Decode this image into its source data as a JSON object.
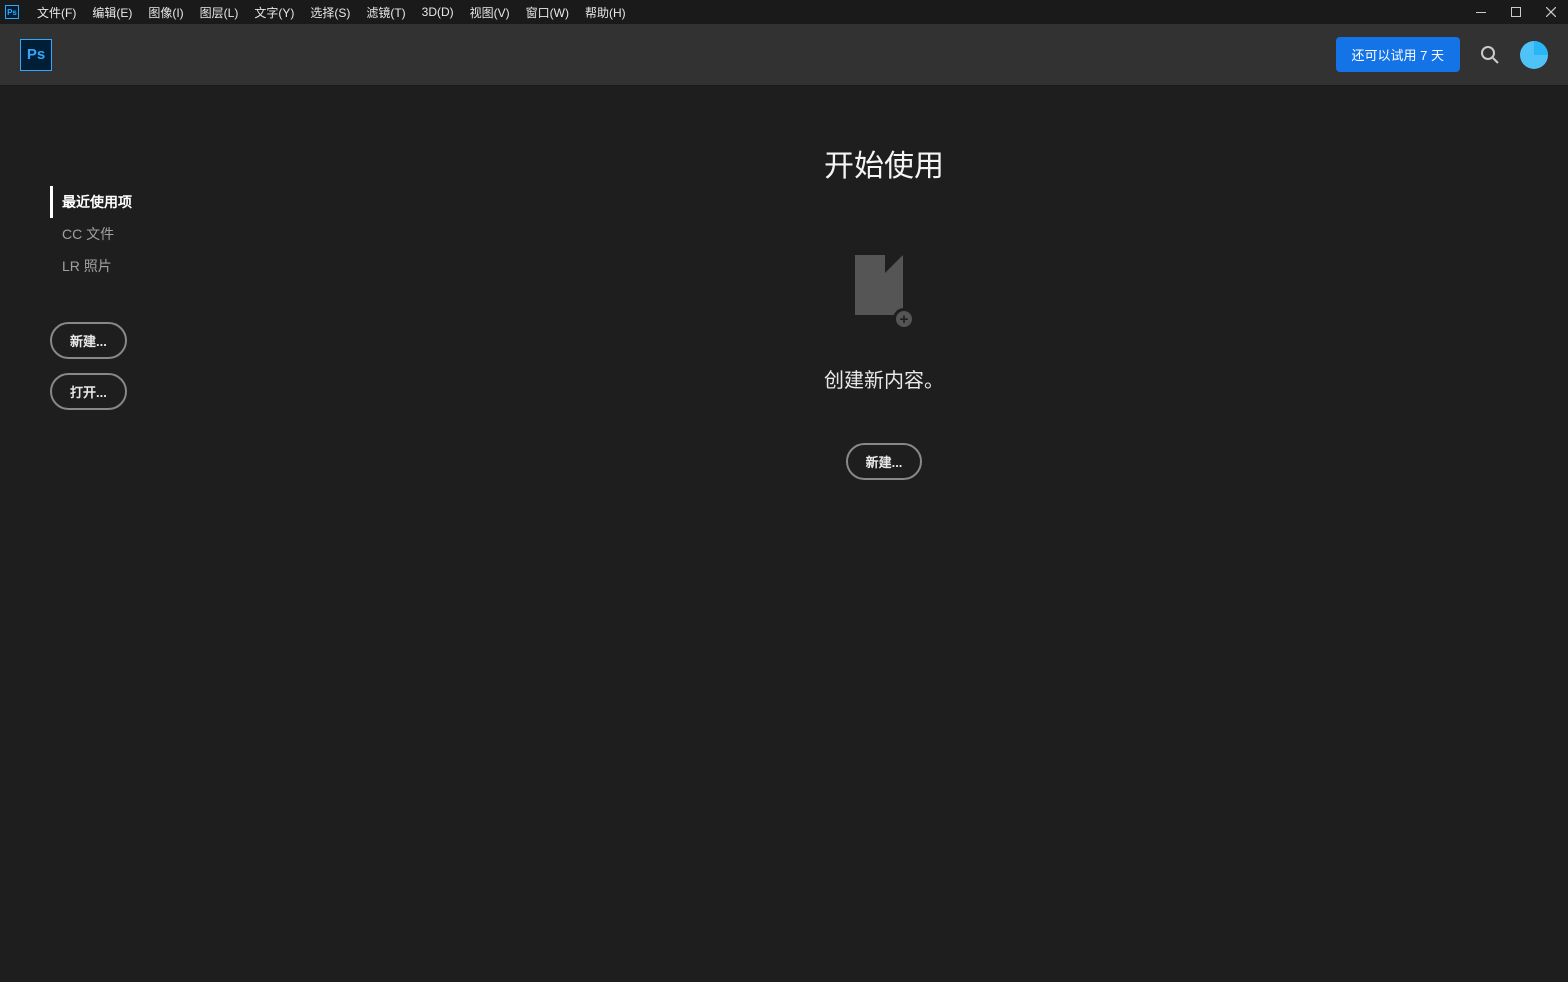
{
  "menubar": {
    "items": [
      "文件(F)",
      "编辑(E)",
      "图像(I)",
      "图层(L)",
      "文字(Y)",
      "选择(S)",
      "滤镜(T)",
      "3D(D)",
      "视图(V)",
      "窗口(W)",
      "帮助(H)"
    ]
  },
  "topbar": {
    "trial_label": "还可以试用 7 天"
  },
  "sidebar": {
    "items": [
      {
        "label": "最近使用项",
        "active": true
      },
      {
        "label": "CC 文件",
        "active": false
      },
      {
        "label": "LR 照片",
        "active": false
      }
    ],
    "new_label": "新建...",
    "open_label": "打开..."
  },
  "content": {
    "title": "开始使用",
    "create_text": "创建新内容。",
    "new_label": "新建..."
  }
}
